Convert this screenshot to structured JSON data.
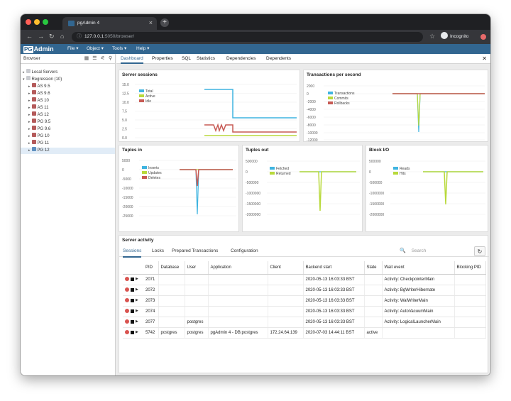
{
  "colors": {
    "chrome_dark": "#1f2023",
    "toolbar": "#35363a",
    "pgadmin_blue": "#326690",
    "series_blue": "#3fb4e0",
    "series_green": "#b8d93b",
    "series_red": "#c75a54"
  },
  "browser_tab": {
    "title": "pgAdmin 4",
    "close_icon": "close-icon"
  },
  "address_bar": {
    "host": "127.0.0.1",
    "rest": ":5050/browser/",
    "incognito": "Incognito"
  },
  "menubar": {
    "logo_prefix": "PG",
    "logo_suffix": "Admin",
    "items": [
      "File ▾",
      "Object ▾",
      "Tools ▾",
      "Help ▾"
    ]
  },
  "browser": {
    "title": "Browser",
    "tree": [
      {
        "label": "Local Servers",
        "arrow": "▸"
      },
      {
        "label": "Regression (10)",
        "arrow": "▾"
      },
      {
        "label": "AS 9.5",
        "arrow": "▸"
      },
      {
        "label": "AS 9.6",
        "arrow": "▸"
      },
      {
        "label": "AS 10",
        "arrow": "▸"
      },
      {
        "label": "AS 11",
        "arrow": "▸"
      },
      {
        "label": "AS 12",
        "arrow": "▸"
      },
      {
        "label": "PG 9.5",
        "arrow": "▸"
      },
      {
        "label": "PG 9.6",
        "arrow": "▸"
      },
      {
        "label": "PG 10",
        "arrow": "▸"
      },
      {
        "label": "PG 11",
        "arrow": "▸"
      },
      {
        "label": "PG 12",
        "arrow": "▸"
      }
    ]
  },
  "main_tabs": [
    "Dashboard",
    "Properties",
    "SQL",
    "Statistics",
    "Dependencies",
    "Dependents"
  ],
  "panels": {
    "server_sessions": {
      "title": "Server sessions",
      "yticks": [
        "15.0",
        "12.5",
        "10.0",
        "7.5",
        "5.0",
        "2.5",
        "0.0"
      ],
      "legend": [
        "Total",
        "Active",
        "Idle"
      ]
    },
    "tps": {
      "title": "Transactions per second",
      "yticks": [
        "2000",
        "0",
        "-2000",
        "-4000",
        "-6000",
        "-8000",
        "-10000",
        "-12000"
      ],
      "legend": [
        "Transactions",
        "Commits",
        "Rollbacks"
      ]
    },
    "tuples_in": {
      "title": "Tuples in",
      "yticks": [
        "5000",
        "0",
        "-5000",
        "-10000",
        "-15000",
        "-20000",
        "-25000"
      ],
      "legend": [
        "Inserts",
        "Updates",
        "Deletes"
      ]
    },
    "tuples_out": {
      "title": "Tuples out",
      "yticks": [
        "500000",
        "0",
        "-500000",
        "-1000000",
        "-1500000",
        "-2000000"
      ],
      "legend": [
        "Fetched",
        "Returned"
      ]
    },
    "block_io": {
      "title": "Block I/O",
      "yticks": [
        "500000",
        "0",
        "-500000",
        "-1000000",
        "-1500000",
        "-2000000"
      ],
      "legend": [
        "Reads",
        "Hits"
      ]
    }
  },
  "activity": {
    "title": "Server activity",
    "tabs": [
      "Sessions",
      "Locks",
      "Prepared Transactions",
      "Configuration"
    ],
    "search_placeholder": "Search",
    "columns": [
      "PID",
      "Database",
      "User",
      "Application",
      "Client",
      "Backend start",
      "State",
      "Wait event",
      "Blocking PID"
    ],
    "rows": [
      [
        "2071",
        "",
        "",
        "",
        "",
        "2020-05-13 16:03:33 BST",
        "",
        "Activity: CheckpointerMain",
        ""
      ],
      [
        "2072",
        "",
        "",
        "",
        "",
        "2020-05-13 16:03:33 BST",
        "",
        "Activity: BgWriterHibernate",
        ""
      ],
      [
        "2073",
        "",
        "",
        "",
        "",
        "2020-05-13 16:03:33 BST",
        "",
        "Activity: WalWriterMain",
        ""
      ],
      [
        "2074",
        "",
        "",
        "",
        "",
        "2020-05-13 16:03:33 BST",
        "",
        "Activity: AutoVacuumMain",
        ""
      ],
      [
        "2077",
        "",
        "postgres",
        "",
        "",
        "2020-05-13 16:03:33 BST",
        "",
        "Activity: LogicalLauncherMain",
        ""
      ],
      [
        "5742",
        "postgres",
        "postgres",
        "pgAdmin 4 - DB:postgres",
        "172.24.64.139",
        "2020-07-03 14:44:11 BST",
        "active",
        "",
        ""
      ]
    ]
  }
}
